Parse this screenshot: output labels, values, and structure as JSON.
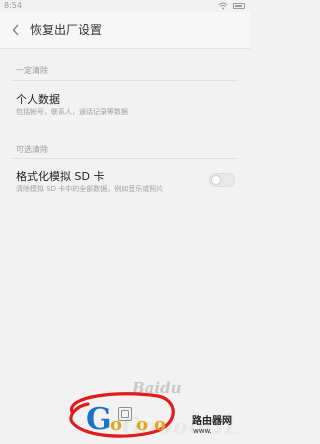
{
  "status_bar": {
    "time": "8:54"
  },
  "header": {
    "title": "恢复出厂设置"
  },
  "sections": [
    {
      "label": "一定清除",
      "items": [
        {
          "title": "个人数据",
          "subtitle": "包括帐号，联系人，通话记录等数据"
        }
      ]
    },
    {
      "label": "可选清除",
      "items": [
        {
          "title": "格式化模拟 SD 卡",
          "subtitle": "清除模拟 SD 卡中的全部数据，例如音乐或照片",
          "toggle": false
        }
      ]
    }
  ],
  "watermark": {
    "logo_text": "Bai",
    "logo_suffix": "du",
    "site": "GooooGL",
    "brand": "路由器网",
    "url": "www.",
    "letters": {
      "g": "G",
      "o": "o"
    }
  },
  "colors": {
    "background": "#f2f2f2",
    "annotation_circle": "#e11a1a",
    "logo_blue": "#1e73c8",
    "logo_orange": "#e6a51a"
  }
}
